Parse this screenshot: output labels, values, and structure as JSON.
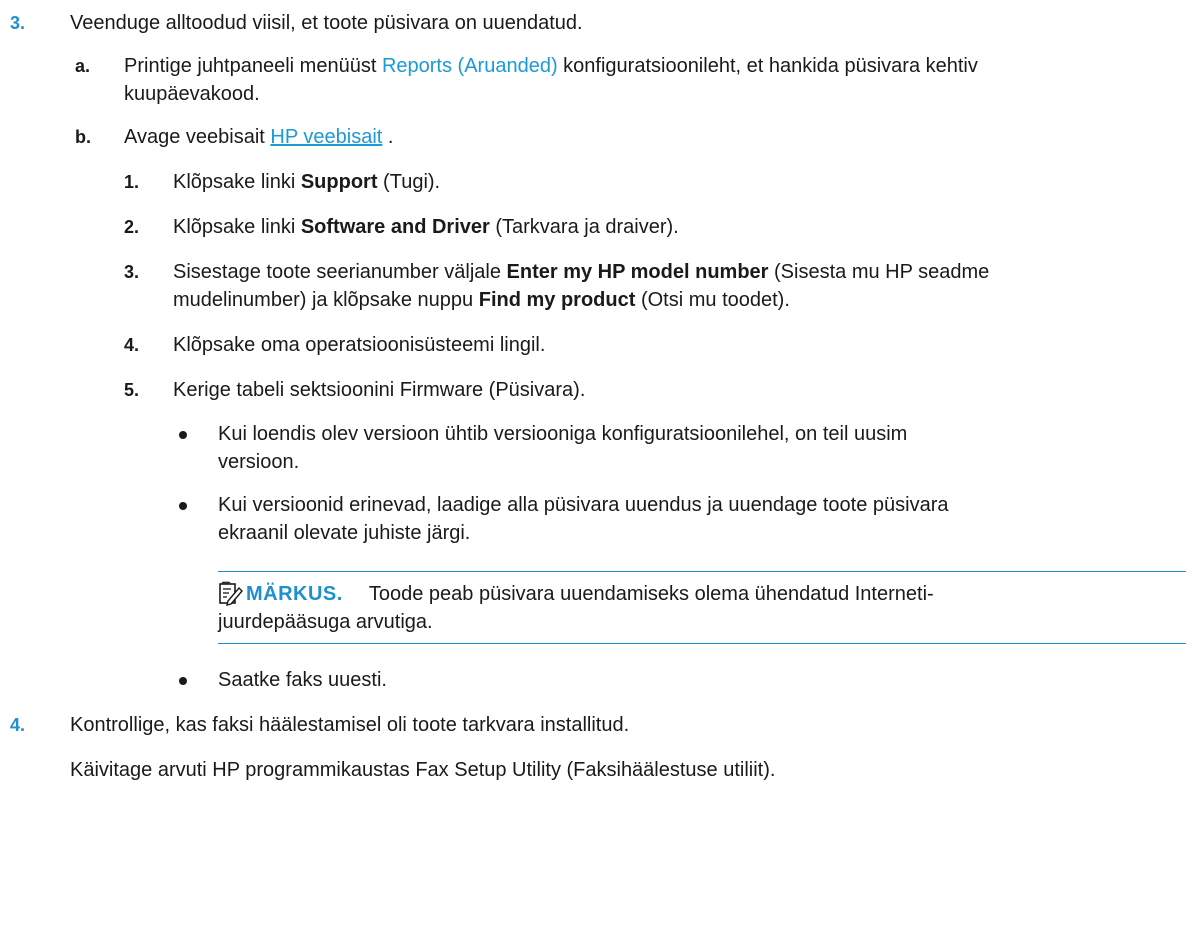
{
  "step3": {
    "number": "3.",
    "text": "Veenduge alltoodud viisil, et toote püsivara on uuendatud.",
    "a": {
      "label": "a.",
      "pre": "Printige juhtpaneeli menüüst ",
      "link": "Reports (Aruanded)",
      "post1": " konfiguratsioonileht, et hankida püsivara kehtiv",
      "post2": "kuupäevakood."
    },
    "b": {
      "label": "b.",
      "pre": "Avage veebisait ",
      "link": "HP veebisait",
      "post": " ."
    },
    "substeps": [
      {
        "num": "1.",
        "pre": "Klõpsake linki ",
        "bold": "Support",
        "post": " (Tugi)."
      },
      {
        "num": "2.",
        "pre": "Klõpsake linki ",
        "bold": "Software and Driver",
        "post": " (Tarkvara ja draiver)."
      },
      {
        "num": "3.",
        "pre": "Sisestage toote seerianumber väljale ",
        "bold": "Enter my HP model number",
        "post": " (Sisesta mu HP seadme",
        "line2_pre": "mudelinumber) ja klõpsake nuppu ",
        "line2_bold": "Find my product",
        "line2_post": " (Otsi mu toodet)."
      },
      {
        "num": "4.",
        "text": "Klõpsake oma operatsioonisüsteemi lingil."
      },
      {
        "num": "5.",
        "text": "Kerige tabeli sektsioonini Firmware (Püsivara)."
      }
    ],
    "bullets": [
      {
        "line1": "Kui loendis olev versioon ühtib versiooniga konfiguratsioonilehel, on teil uusim",
        "line2": "versioon."
      },
      {
        "line1": "Kui versioonid erinevad, laadige alla püsivara uuendus ja uuendage toote püsivara",
        "line2": "ekraanil olevate juhiste järgi."
      }
    ],
    "note": {
      "label": "MÄRKUS.",
      "line1": "Toode peab püsivara uuendamiseks olema ühendatud Interneti-",
      "line2": "juurdepääsuga arvutiga."
    },
    "last_bullet": "Saatke faks uuesti."
  },
  "step4": {
    "number": "4.",
    "text": "Kontrollige, kas faksi häälestamisel oli toote tarkvara installitud.",
    "detail": "Käivitage arvuti HP programmikaustas Fax Setup Utility (Faksihäälestuse utiliit)."
  },
  "colors": {
    "accent": "#1f8fd0",
    "link": "#1c9ad6",
    "text": "#1a1a1a"
  }
}
